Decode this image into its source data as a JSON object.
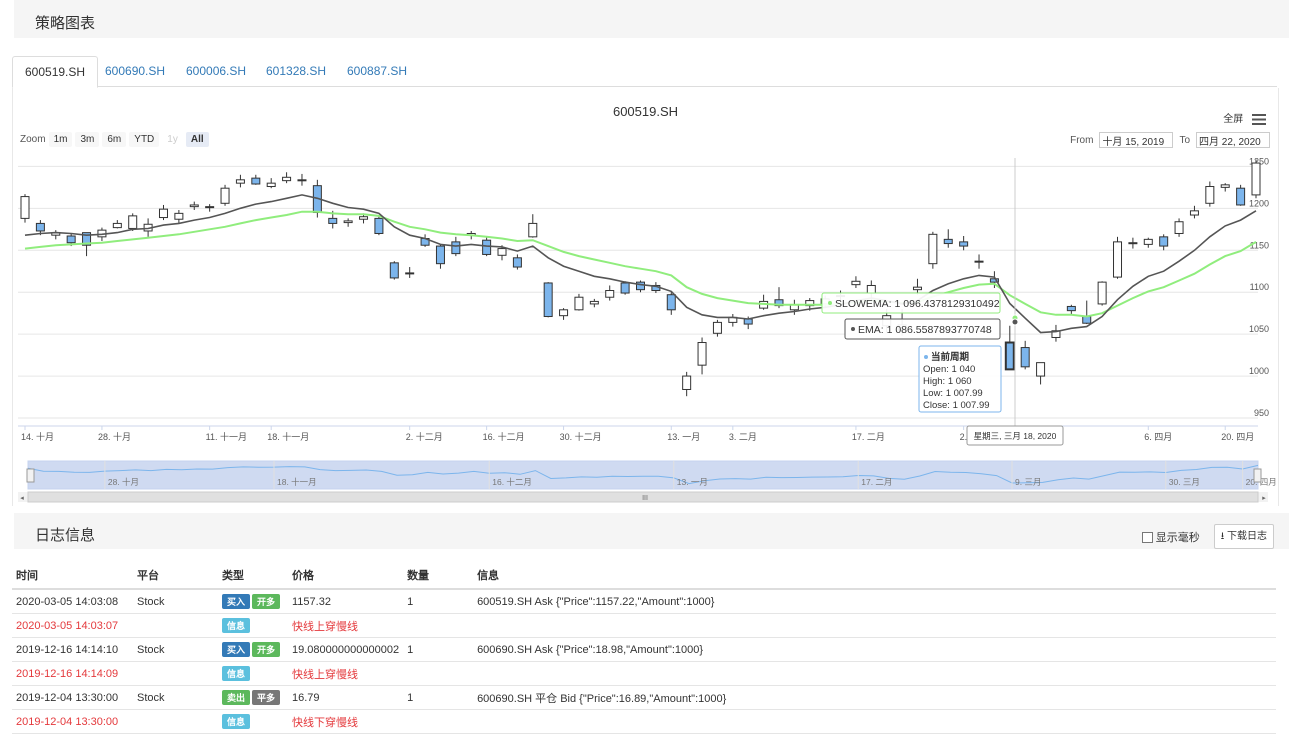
{
  "strategy_panel": {
    "title": "策略图表"
  },
  "tabs": [
    {
      "label": "600519.SH"
    },
    {
      "label": "600690.SH"
    },
    {
      "label": "600006.SH"
    },
    {
      "label": "601328.SH"
    },
    {
      "label": "600887.SH"
    }
  ],
  "chart": {
    "title": "600519.SH",
    "fullscreen_label": "全屏",
    "zoom_label": "Zoom",
    "zoom_buttons": [
      "1m",
      "3m",
      "6m",
      "YTD",
      "1y",
      "All"
    ],
    "zoom_active": "All",
    "zoom_disabled": "1y",
    "from_label": "From",
    "from_value": "十月 15, 2019",
    "to_label": "To",
    "to_value": "四月 22, 2020",
    "y_ticks": [
      "1250",
      "1200",
      "1150",
      "1100",
      "1050",
      "1000",
      "950"
    ],
    "x_ticks": [
      "14. 十月",
      "28. 十月",
      "11. 十一月",
      "18. 十一月",
      "2. 十二月",
      "16. 十二月",
      "30. 十二月",
      "13. 一月",
      "3. 二月",
      "17. 二月",
      "2. 三月",
      "9. 三月",
      "6. 四月",
      "20. 四月"
    ],
    "navigator_ticks": [
      "28. 十月",
      "18. 十一月",
      "16. 十二月",
      "13. 一月",
      "17. 二月",
      "9. 三月",
      "30. 三月",
      "20. 四月"
    ],
    "tooltip_slowema": "SLOWEMA: 1 096.4378129310492",
    "tooltip_ema": "EMA: 1 086.5587893770748",
    "tooltip_ohlc": {
      "title": "当前周期",
      "open": "Open: 1 040",
      "high": "High: 1 060",
      "low": "Low: 1 007.99",
      "close": "Close: 1 007.99"
    },
    "crosshair_date": "星期三, 三月 18, 2020",
    "colors": {
      "up": "#ffffff",
      "down": "#7cb5ec",
      "ema": "#555555",
      "slowema": "#90ed7d",
      "navigator": "#7cb5ec"
    }
  },
  "chart_data": {
    "type": "candlestick",
    "title": "600519.SH",
    "ylim": [
      950,
      1260
    ],
    "candles": [
      [
        1188,
        1217,
        1183,
        1214
      ],
      [
        1182,
        1186,
        1168,
        1173
      ],
      [
        1168,
        1174,
        1163,
        1171
      ],
      [
        1167,
        1170,
        1155,
        1159
      ],
      [
        1171,
        1171,
        1143,
        1156
      ],
      [
        1166,
        1177,
        1161,
        1174
      ],
      [
        1177,
        1186,
        1176,
        1182
      ],
      [
        1176,
        1194,
        1173,
        1191
      ],
      [
        1173,
        1188,
        1166,
        1181
      ],
      [
        1189,
        1204,
        1186,
        1199
      ],
      [
        1187,
        1198,
        1182,
        1194
      ],
      [
        1202,
        1208,
        1198,
        1204
      ],
      [
        1201,
        1205,
        1196,
        1202
      ],
      [
        1206,
        1228,
        1203,
        1224
      ],
      [
        1230,
        1240,
        1225,
        1234
      ],
      [
        1236,
        1240,
        1228,
        1229
      ],
      [
        1226,
        1236,
        1224,
        1230
      ],
      [
        1233,
        1243,
        1230,
        1237
      ],
      [
        1234,
        1241,
        1227,
        1234
      ],
      [
        1227,
        1234,
        1189,
        1195
      ],
      [
        1188,
        1197,
        1176,
        1182
      ],
      [
        1183,
        1188,
        1178,
        1185
      ],
      [
        1187,
        1194,
        1182,
        1190
      ],
      [
        1188,
        1192,
        1168,
        1170
      ],
      [
        1135,
        1137,
        1115,
        1117
      ],
      [
        1123,
        1130,
        1117,
        1123
      ],
      [
        1164,
        1169,
        1154,
        1156
      ],
      [
        1155,
        1157,
        1128,
        1134
      ],
      [
        1160,
        1166,
        1143,
        1146
      ],
      [
        1168,
        1173,
        1163,
        1170
      ],
      [
        1162,
        1166,
        1143,
        1145
      ],
      [
        1144,
        1156,
        1138,
        1152
      ],
      [
        1141,
        1145,
        1127,
        1130
      ],
      [
        1166,
        1193,
        1165,
        1182
      ],
      [
        1111,
        1112,
        1070,
        1071
      ],
      [
        1072,
        1081,
        1067,
        1079
      ],
      [
        1079,
        1098,
        1078,
        1094
      ],
      [
        1086,
        1092,
        1082,
        1089
      ],
      [
        1094,
        1108,
        1090,
        1102
      ],
      [
        1111,
        1113,
        1097,
        1099
      ],
      [
        1112,
        1114,
        1100,
        1103
      ],
      [
        1108,
        1112,
        1099,
        1102
      ],
      [
        1097,
        1100,
        1073,
        1079
      ],
      [
        984,
        1005,
        976,
        1000
      ],
      [
        1013,
        1046,
        1002,
        1040
      ],
      [
        1051,
        1067,
        1047,
        1064
      ],
      [
        1064,
        1074,
        1059,
        1070
      ],
      [
        1068,
        1071,
        1056,
        1062
      ],
      [
        1081,
        1097,
        1079,
        1089
      ],
      [
        1091,
        1106,
        1081,
        1084
      ],
      [
        1079,
        1091,
        1073,
        1085
      ],
      [
        1084,
        1093,
        1078,
        1090
      ],
      [
        1086,
        1096,
        1081,
        1092
      ],
      [
        1095,
        1102,
        1090,
        1096
      ],
      [
        1109,
        1119,
        1105,
        1113
      ],
      [
        1099,
        1114,
        1086,
        1108
      ],
      [
        1060,
        1080,
        1052,
        1072
      ],
      [
        1055,
        1080,
        1048,
        1061
      ],
      [
        1103,
        1116,
        1097,
        1106
      ],
      [
        1134,
        1172,
        1128,
        1169
      ],
      [
        1163,
        1175,
        1153,
        1158
      ],
      [
        1160,
        1167,
        1150,
        1155
      ],
      [
        1136,
        1145,
        1128,
        1137
      ],
      [
        1116,
        1125,
        1105,
        1112
      ],
      [
        1040,
        1060,
        1007.99,
        1007.99
      ],
      [
        1034,
        1042,
        1008,
        1011
      ],
      [
        1000,
        1016,
        990,
        1016
      ],
      [
        1046,
        1061,
        1041,
        1054
      ],
      [
        1083,
        1085,
        1074,
        1078
      ],
      [
        1071,
        1090,
        1062,
        1063
      ],
      [
        1086,
        1113,
        1084,
        1112
      ],
      [
        1118,
        1166,
        1116,
        1160
      ],
      [
        1158,
        1165,
        1152,
        1159
      ],
      [
        1157,
        1165,
        1153,
        1163
      ],
      [
        1166,
        1169,
        1150,
        1155
      ],
      [
        1170,
        1188,
        1166,
        1184
      ],
      [
        1192,
        1203,
        1188,
        1197
      ],
      [
        1206,
        1232,
        1202,
        1226
      ],
      [
        1225,
        1230,
        1220,
        1228
      ],
      [
        1224,
        1228,
        1203,
        1204
      ],
      [
        1216,
        1258,
        1212,
        1254
      ]
    ],
    "ema": [
      1168,
      1170,
      1171,
      1170,
      1168,
      1169,
      1171,
      1175,
      1176,
      1180,
      1182,
      1186,
      1189,
      1194,
      1200,
      1205,
      1208,
      1212,
      1216,
      1212,
      1206,
      1201,
      1199,
      1194,
      1178,
      1168,
      1164,
      1157,
      1155,
      1157,
      1155,
      1154,
      1149,
      1155,
      1141,
      1131,
      1125,
      1119,
      1116,
      1112,
      1109,
      1107,
      1101,
      1082,
      1073,
      1070,
      1070,
      1068,
      1072,
      1075,
      1077,
      1080,
      1082,
      1085,
      1090,
      1093,
      1090,
      1086,
      1090,
      1102,
      1110,
      1116,
      1120,
      1118,
      1086.56,
      1069,
      1052,
      1053,
      1057,
      1059,
      1071,
      1091,
      1107,
      1119,
      1125,
      1137,
      1150,
      1166,
      1179,
      1186,
      1197
    ],
    "slowema": [
      1152,
      1154,
      1156,
      1157,
      1158,
      1159,
      1161,
      1163,
      1165,
      1167,
      1169,
      1172,
      1175,
      1178,
      1182,
      1186,
      1189,
      1192,
      1196,
      1196,
      1194,
      1193,
      1193,
      1191,
      1184,
      1178,
      1175,
      1171,
      1169,
      1168,
      1166,
      1164,
      1161,
      1162,
      1155,
      1148,
      1143,
      1139,
      1135,
      1131,
      1128,
      1125,
      1120,
      1106,
      1098,
      1093,
      1090,
      1087,
      1086,
      1085,
      1085,
      1085,
      1085,
      1086,
      1088,
      1090,
      1089,
      1087,
      1088,
      1095,
      1100,
      1105,
      1109,
      1110,
      1096.44,
      1086,
      1076,
      1073,
      1073,
      1071,
      1075,
      1084,
      1093,
      1101,
      1106,
      1114,
      1122,
      1133,
      1143,
      1149,
      1160
    ]
  },
  "log_panel": {
    "title": "日志信息",
    "show_ms_label": "显示毫秒",
    "download_label": "下载日志",
    "columns": [
      "时间",
      "平台",
      "类型",
      "价格",
      "数量",
      "信息"
    ],
    "rows": [
      {
        "time": "2020-03-05 14:03:08",
        "platform": "Stock",
        "badges": [
          {
            "text": "买入",
            "kind": "buy"
          },
          {
            "text": "开多",
            "kind": "long"
          }
        ],
        "price": "1157.32",
        "qty": "1",
        "info": "600519.SH Ask {\"Price\":1157.22,\"Amount\":1000}",
        "red": false
      },
      {
        "time": "2020-03-05 14:03:07",
        "platform": "",
        "badges": [
          {
            "text": "信息",
            "kind": "info"
          }
        ],
        "price": "快线上穿慢线",
        "qty": "",
        "info": "",
        "red": true
      },
      {
        "time": "2019-12-16 14:14:10",
        "platform": "Stock",
        "badges": [
          {
            "text": "买入",
            "kind": "buy"
          },
          {
            "text": "开多",
            "kind": "long"
          }
        ],
        "price": "19.080000000000002",
        "qty": "1",
        "info": "600690.SH Ask {\"Price\":18.98,\"Amount\":1000}",
        "red": false
      },
      {
        "time": "2019-12-16 14:14:09",
        "platform": "",
        "badges": [
          {
            "text": "信息",
            "kind": "info"
          }
        ],
        "price": "快线上穿慢线",
        "qty": "",
        "info": "",
        "red": true
      },
      {
        "time": "2019-12-04 13:30:00",
        "platform": "Stock",
        "badges": [
          {
            "text": "卖出",
            "kind": "sell"
          },
          {
            "text": "平多",
            "kind": "flat"
          }
        ],
        "price": "16.79",
        "qty": "1",
        "info": "600690.SH 平仓 Bid {\"Price\":16.89,\"Amount\":1000}",
        "red": false
      },
      {
        "time": "2019-12-04 13:30:00",
        "platform": "",
        "badges": [
          {
            "text": "信息",
            "kind": "info"
          }
        ],
        "price": "快线下穿慢线",
        "qty": "",
        "info": "",
        "red": true
      }
    ]
  }
}
